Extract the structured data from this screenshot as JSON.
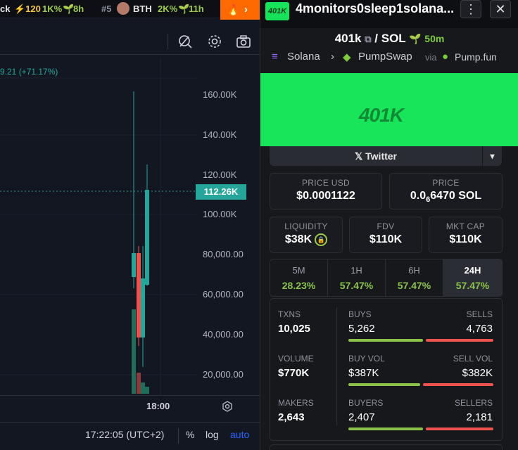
{
  "ticker_bar": {
    "item1_name": "ck",
    "item1_boost": "⚡120",
    "item1_change": "1K%",
    "item1_age": "8h",
    "item2_rank": "#5",
    "item2_name": "BTH",
    "item2_change": "2K%",
    "item2_age": "11h"
  },
  "chart": {
    "change_label": "9.21 (+71.17%)",
    "price_labels": [
      "160.00K",
      "140.00K",
      "120.00K",
      "100.00K",
      "80,000.00",
      "60,000.00",
      "40,000.00",
      "20,000.00"
    ],
    "current_price": "112.26K",
    "time_label": "18:00",
    "clock": "17:22:05 (UTC+2)",
    "percent_label": "%",
    "log_label": "log",
    "auto_label": "auto"
  },
  "header": {
    "logo_text": "401K",
    "token_name": "4monitors0sleep1solana..."
  },
  "pair": {
    "base": "401k",
    "quote": "SOL",
    "age": "50m"
  },
  "route": {
    "chain": "Solana",
    "dex": "PumpSwap",
    "via": "via",
    "launchpad": "Pump.fun"
  },
  "banner": {
    "logo_text": "401K"
  },
  "twitter": {
    "label": "Twitter"
  },
  "price_usd": {
    "label": "PRICE USD",
    "value": "$0.0001122"
  },
  "price_sol": {
    "label": "PRICE",
    "value_prefix": "0.0",
    "subscript": "6",
    "value_suffix": "6470 SOL"
  },
  "liquidity": {
    "label": "LIQUIDITY",
    "value": "$38K"
  },
  "fdv": {
    "label": "FDV",
    "value": "$110K"
  },
  "mkt_cap": {
    "label": "MKT CAP",
    "value": "$110K"
  },
  "tabs": [
    {
      "label": "5M",
      "value": "28.23%"
    },
    {
      "label": "1H",
      "value": "57.47%"
    },
    {
      "label": "6H",
      "value": "57.47%"
    },
    {
      "label": "24H",
      "value": "57.47%"
    }
  ],
  "stats": {
    "txns_label": "TXNS",
    "txns": "10,025",
    "buys_label": "BUYS",
    "buys": "5,262",
    "sells_label": "SELLS",
    "sells": "4,763",
    "volume_label": "VOLUME",
    "volume": "$770K",
    "buy_vol_label": "BUY VOL",
    "buy_vol": "$387K",
    "sell_vol_label": "SELL VOL",
    "sell_vol": "$382K",
    "makers_label": "MAKERS",
    "makers": "2,643",
    "buyers_label": "BUYERS",
    "buyers": "2,407",
    "sellers_label": "SELLERS",
    "sellers": "2,181",
    "buys_ratio": 0.525,
    "buy_vol_ratio": 0.503,
    "buyers_ratio": 0.525
  },
  "colors": {
    "up": "#26a69a",
    "down": "#ef5350",
    "accent_green": "#19e55a",
    "positive_text": "#8bc34a"
  }
}
